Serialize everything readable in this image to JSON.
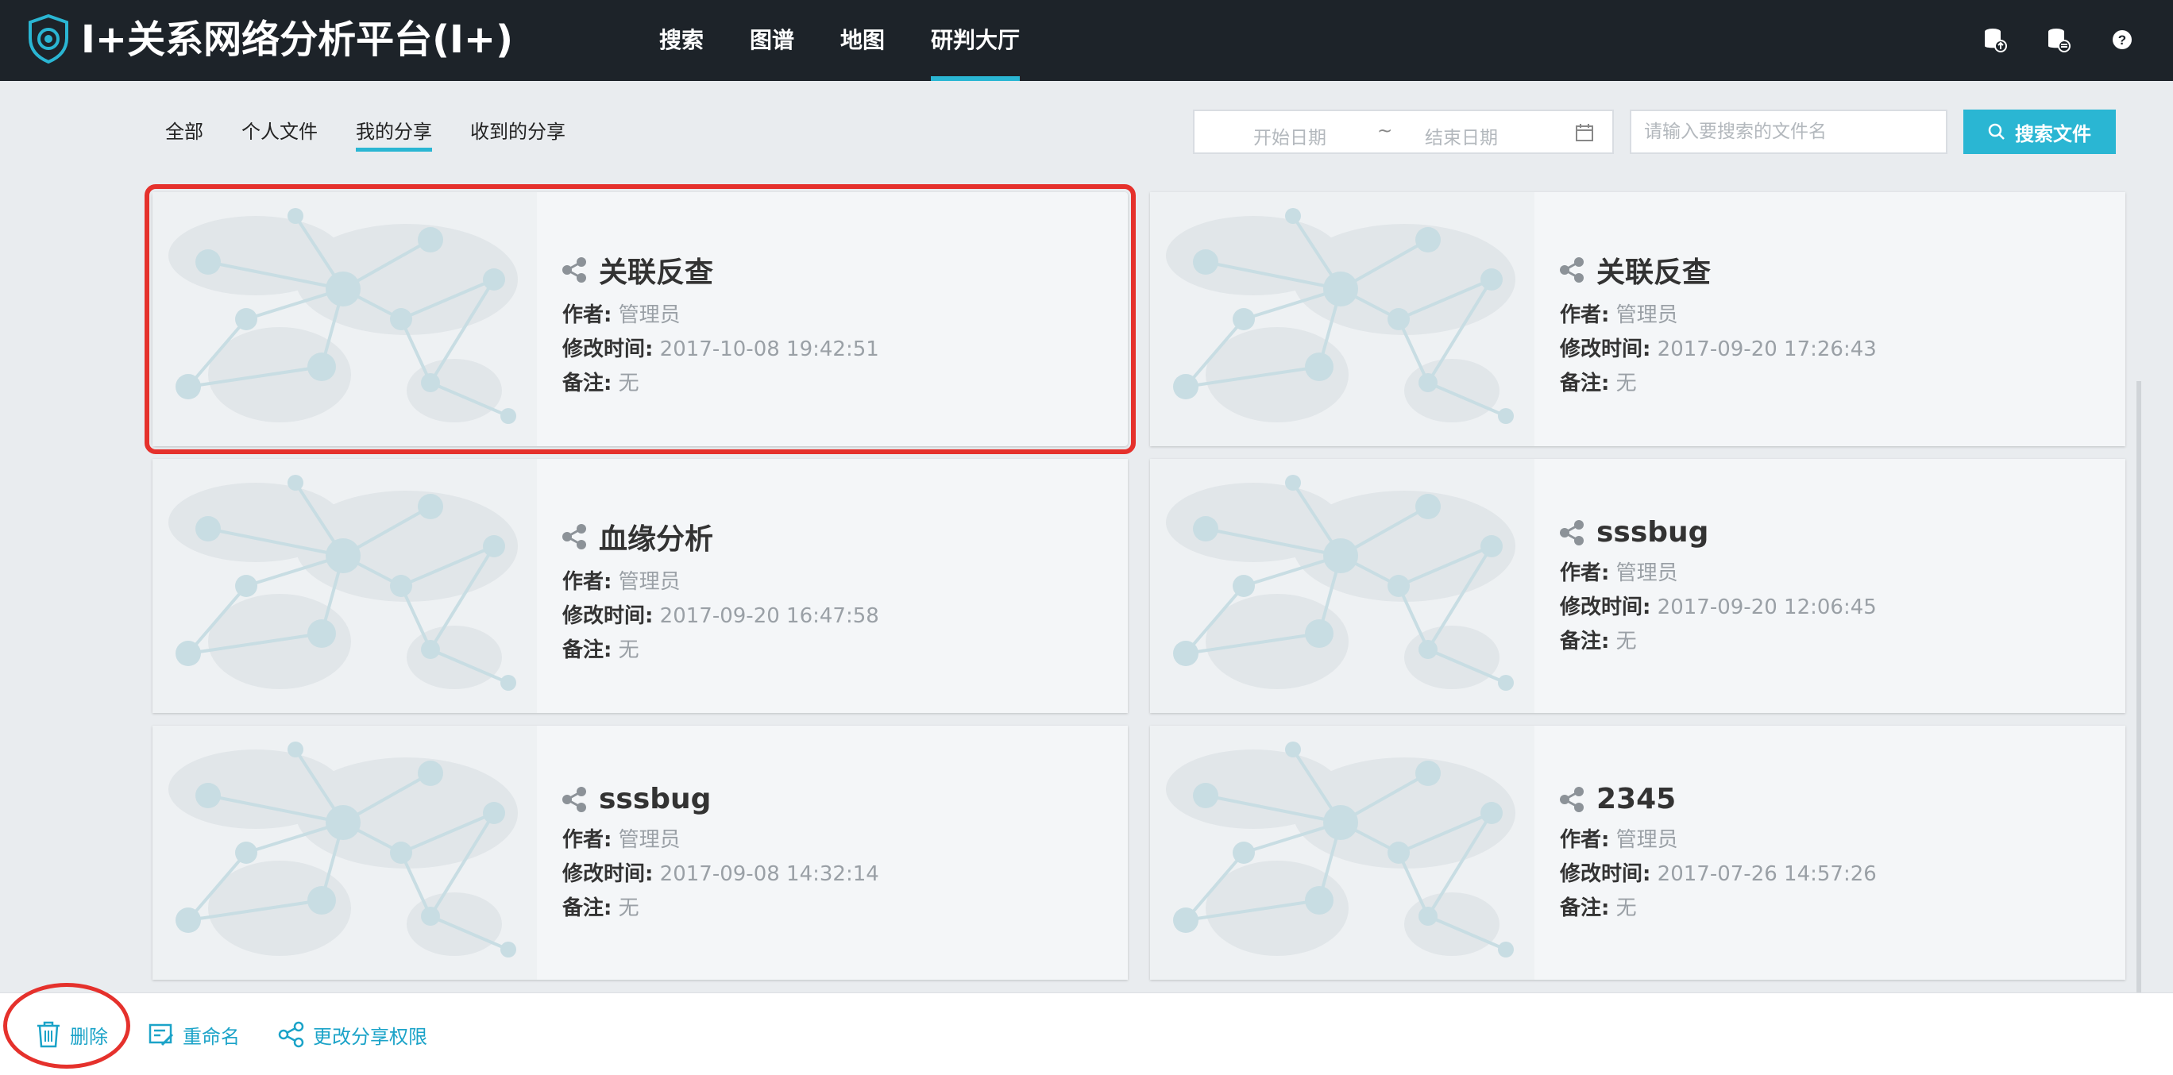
{
  "app": {
    "title": "I+关系网络分析平台(I+)"
  },
  "nav": {
    "items": [
      "搜索",
      "图谱",
      "地图",
      "研判大厅"
    ],
    "active_index": 3
  },
  "top_icons": [
    "database-upload-icon",
    "database-list-icon",
    "help-icon"
  ],
  "subtabs": {
    "items": [
      "全部",
      "个人文件",
      "我的分享",
      "收到的分享"
    ],
    "active_index": 2
  },
  "filters": {
    "start_placeholder": "开始日期",
    "separator": "~",
    "end_placeholder": "结束日期",
    "search_placeholder": "请输入要搜索的文件名",
    "search_button": "搜索文件"
  },
  "labels": {
    "author": "作者:",
    "modified": "修改时间:",
    "note": "备注:"
  },
  "cards": [
    {
      "title": "关联反查",
      "author": "管理员",
      "modified": "2017-10-08 19:42:51",
      "note": "无",
      "selected": true
    },
    {
      "title": "关联反查",
      "author": "管理员",
      "modified": "2017-09-20 17:26:43",
      "note": "无",
      "selected": false
    },
    {
      "title": "血缘分析",
      "author": "管理员",
      "modified": "2017-09-20 16:47:58",
      "note": "无",
      "selected": false
    },
    {
      "title": "sssbug",
      "author": "管理员",
      "modified": "2017-09-20 12:06:45",
      "note": "无",
      "selected": false
    },
    {
      "title": "sssbug",
      "author": "管理员",
      "modified": "2017-09-08 14:32:14",
      "note": "无",
      "selected": false
    },
    {
      "title": "2345",
      "author": "管理员",
      "modified": "2017-07-26 14:57:26",
      "note": "无",
      "selected": false
    }
  ],
  "toolbar": {
    "delete": "删除",
    "rename": "重命名",
    "change_share": "更改分享权限"
  },
  "colors": {
    "accent": "#2ab6d3",
    "topbar": "#1d2329",
    "highlight": "#e5312c"
  }
}
